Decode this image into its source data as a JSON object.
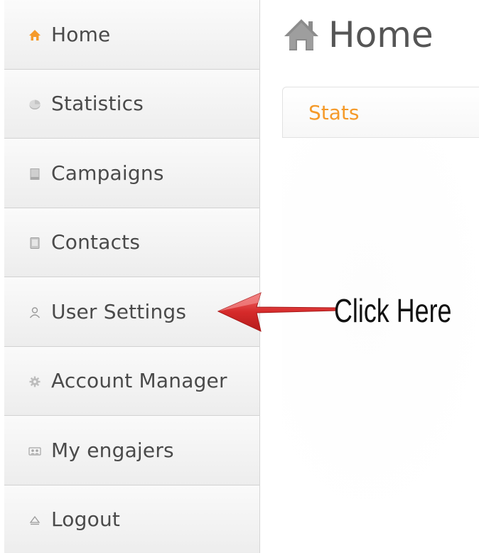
{
  "sidebar": {
    "items": [
      {
        "label": "Home",
        "icon": "home-icon",
        "icon_color": "#f59a2a"
      },
      {
        "label": "Statistics",
        "icon": "pie-chart-icon"
      },
      {
        "label": "Campaigns",
        "icon": "document-icon"
      },
      {
        "label": "Contacts",
        "icon": "address-book-icon"
      },
      {
        "label": "User Settings",
        "icon": "user-icon"
      },
      {
        "label": "Account Manager",
        "icon": "gear-icon"
      },
      {
        "label": "My engajers",
        "icon": "group-icon"
      },
      {
        "label": "Logout",
        "icon": "eject-icon"
      }
    ]
  },
  "main": {
    "title": "Home",
    "title_icon": "home-icon",
    "tabs": [
      {
        "label": "Stats",
        "active": true
      }
    ]
  },
  "annotation": {
    "text": "Click Here",
    "arrow_color": "#d62a2a"
  },
  "colors": {
    "accent": "#f59a2a",
    "sidebar_bg": "#f3f3f3",
    "text": "#4a4a4a"
  }
}
